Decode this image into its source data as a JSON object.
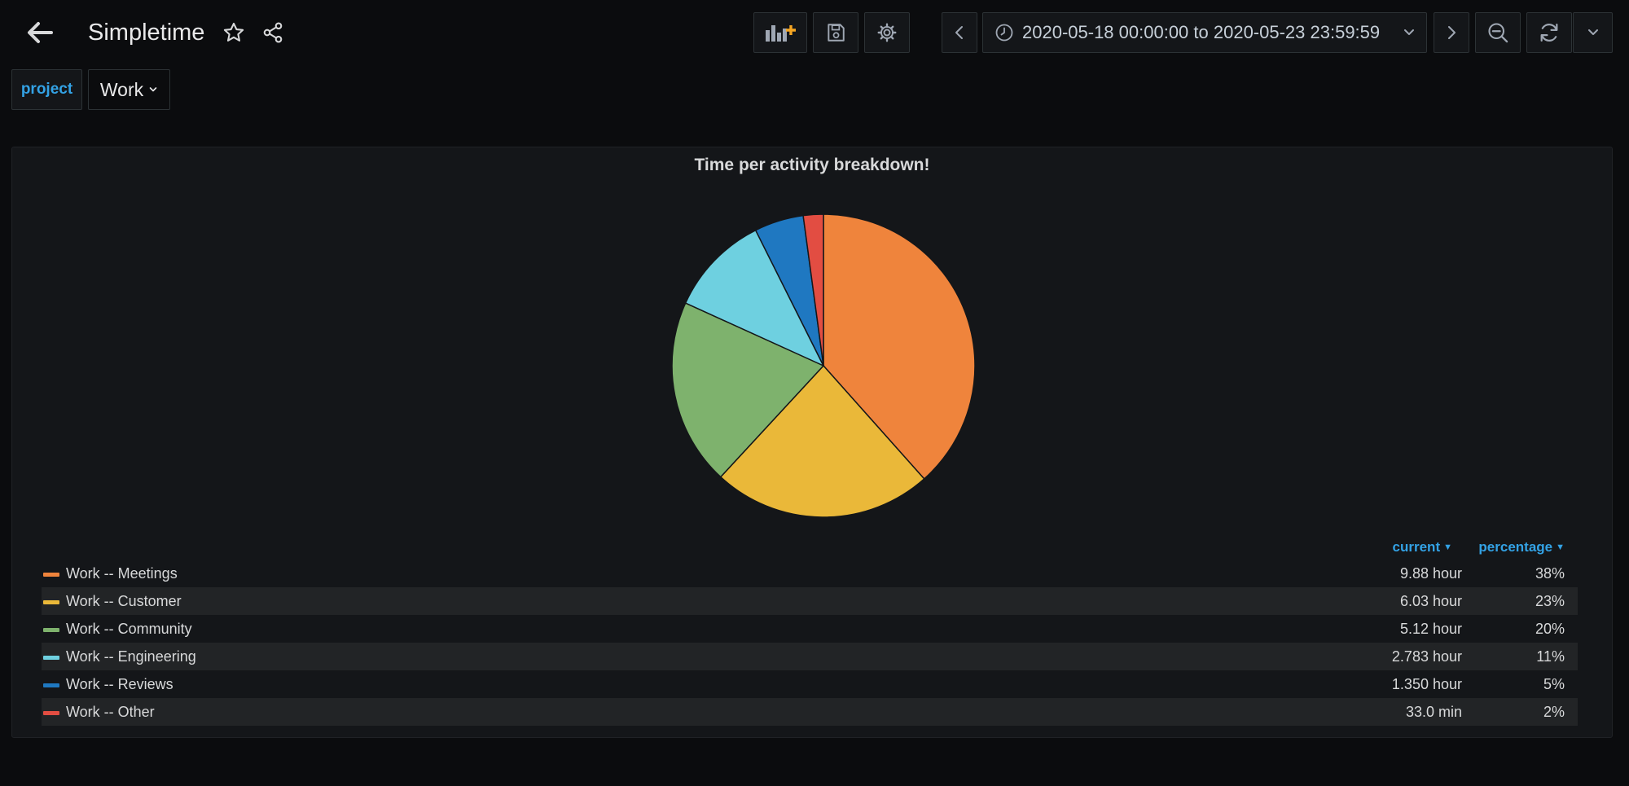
{
  "header": {
    "title": "Simpletime",
    "time_range": "2020-05-18 00:00:00 to 2020-05-23 23:59:59",
    "icons": {
      "back": "arrow-left-icon",
      "star": "star-icon",
      "share": "share-icon",
      "add_panel": "add-panel-icon",
      "save": "save-icon",
      "settings": "gear-icon",
      "shift_back": "chevron-left-icon",
      "clock": "clock-icon",
      "shift_forward": "chevron-right-icon",
      "zoom_out": "zoom-out-icon",
      "refresh": "refresh-icon",
      "refresh_interval": "chevron-down-icon"
    }
  },
  "variables": {
    "label": "project",
    "value": "Work"
  },
  "panel": {
    "title": "Time per activity breakdown!",
    "legend_headers": {
      "current": "current",
      "percentage": "percentage"
    }
  },
  "legend": [
    {
      "name": "Work -- Meetings",
      "current": "9.88 hour",
      "percentage": "38%"
    },
    {
      "name": "Work -- Customer",
      "current": "6.03 hour",
      "percentage": "23%"
    },
    {
      "name": "Work -- Community",
      "current": "5.12 hour",
      "percentage": "20%"
    },
    {
      "name": "Work -- Engineering",
      "current": "2.783 hour",
      "percentage": "11%"
    },
    {
      "name": "Work -- Reviews",
      "current": "1.350 hour",
      "percentage": "5%"
    },
    {
      "name": "Work -- Other",
      "current": "33.0 min",
      "percentage": "2%"
    }
  ],
  "colors": {
    "accent": "#33a2e5",
    "background": "#0b0c0e",
    "panel": "#141619"
  },
  "chart_data": {
    "type": "pie",
    "title": "Time per activity breakdown!",
    "categories": [
      "Work -- Meetings",
      "Work -- Customer",
      "Work -- Community",
      "Work -- Engineering",
      "Work -- Reviews",
      "Work -- Other"
    ],
    "values": [
      9.88,
      6.03,
      5.12,
      2.783,
      1.35,
      0.55
    ],
    "unit": "hour",
    "colors": [
      "#ef843c",
      "#eab839",
      "#7eb26d",
      "#6ed0e0",
      "#1f78c1",
      "#e24d42"
    ],
    "legend_placement": "bottom"
  }
}
